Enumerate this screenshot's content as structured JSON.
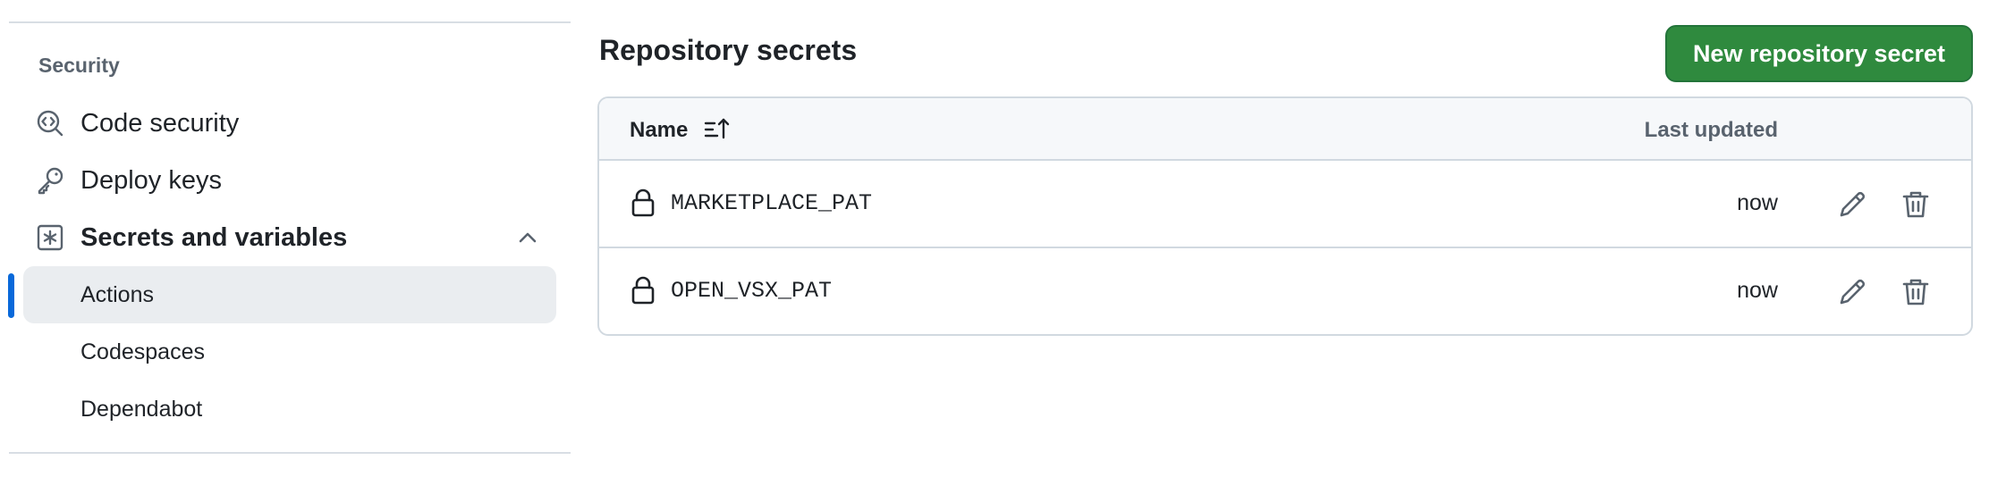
{
  "sidebar": {
    "section_heading": "Security",
    "items": [
      {
        "label": "Code security",
        "icon": "code-security-icon"
      },
      {
        "label": "Deploy keys",
        "icon": "key-icon"
      },
      {
        "label": "Secrets and variables",
        "icon": "asterisk-box-icon",
        "expanded": true
      }
    ],
    "sub_items": [
      {
        "label": "Actions",
        "active": true
      },
      {
        "label": "Codespaces",
        "active": false
      },
      {
        "label": "Dependabot",
        "active": false
      }
    ]
  },
  "main": {
    "title": "Repository secrets",
    "new_button_label": "New repository secret",
    "table": {
      "col_name": "Name",
      "col_updated": "Last updated",
      "sort_icon": "sort-ascending-icon",
      "rows": [
        {
          "name": "MARKETPLACE_PAT",
          "updated": "now"
        },
        {
          "name": "OPEN_VSX_PAT",
          "updated": "now"
        }
      ]
    }
  },
  "colors": {
    "accent_blue": "#0969da",
    "button_green": "#2f8a3e",
    "active_bg": "#eaedf0",
    "border": "#d1d9e0"
  }
}
